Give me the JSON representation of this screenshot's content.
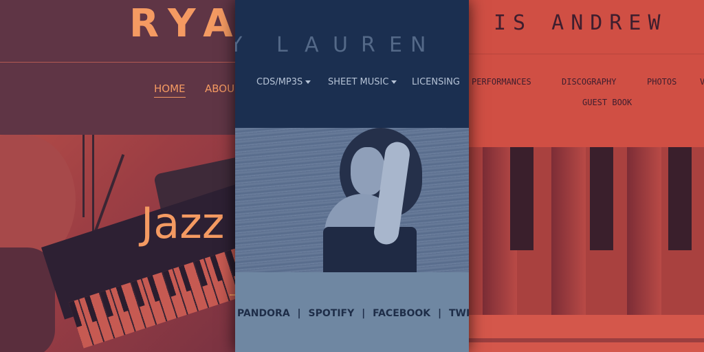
{
  "left_site": {
    "brand": "RYA",
    "nav": [
      "HOME",
      "ABOU"
    ],
    "hero_text": "Jazz"
  },
  "middle_site": {
    "brand_letters": [
      "Y",
      "L",
      "A",
      "U",
      "R",
      "E",
      "N"
    ],
    "menu": [
      {
        "label": "CDS/MP3S",
        "dropdown": true
      },
      {
        "label": "SHEET MUSIC",
        "dropdown": true
      },
      {
        "label": "LICENSING",
        "dropdown": false
      }
    ],
    "social": [
      "PANDORA",
      "SPOTIFY",
      "FACEBOOK",
      "TWITTER"
    ],
    "separator": "|"
  },
  "right_site": {
    "brand": "IS ANDREW",
    "menu": [
      "PERFORMANCES",
      "DISCOGRAPHY",
      "PHOTOS",
      "V"
    ],
    "menu_row2": [
      "GUEST BOOK"
    ]
  },
  "colors": {
    "left_accent": "#f49a62",
    "middle_bg": "#1b2f50",
    "right_bg": "#d04f44"
  }
}
